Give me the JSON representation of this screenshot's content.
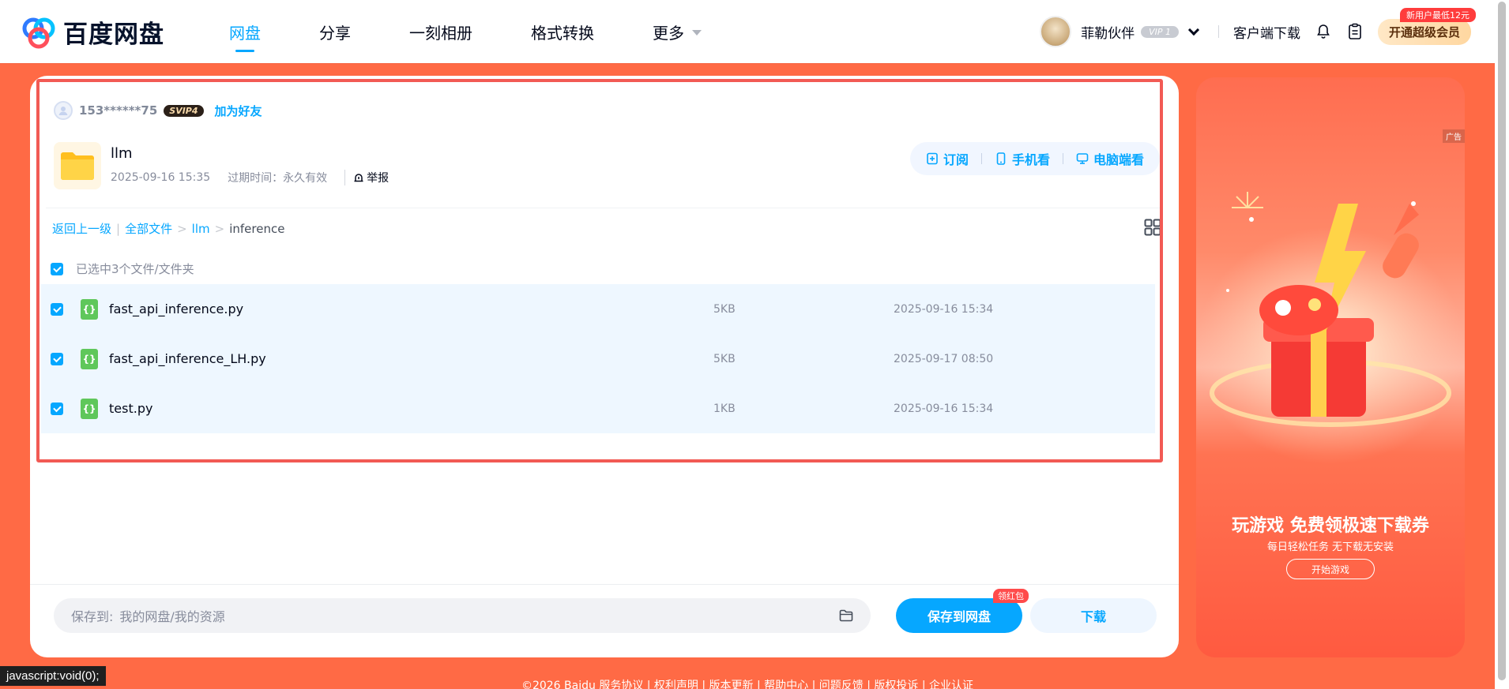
{
  "brand": {
    "name": "百度网盘"
  },
  "nav": [
    {
      "label": "网盘"
    },
    {
      "label": "分享"
    },
    {
      "label": "一刻相册"
    },
    {
      "label": "格式转换"
    },
    {
      "label": "更多"
    }
  ],
  "user": {
    "name": "菲勒伙伴",
    "vip_level": "VIP 1",
    "client_download": "客户端下载",
    "super_vip": "开通超级会员",
    "promo": "新用户最低12元"
  },
  "share": {
    "sharer_id": "153******75",
    "sharer_vip": "SVIP4",
    "add_friend": "加为好友",
    "folder_name": "llm",
    "created": "2025-09-16 15:35",
    "expire": "过期时间：永久有效",
    "report": "举报",
    "actions": {
      "subscribe": "订阅",
      "mobile": "手机看",
      "pc": "电脑端看"
    }
  },
  "breadcrumb": {
    "back": "返回上一级",
    "all": "全部文件",
    "parent": "llm",
    "current": "inference"
  },
  "selection": {
    "text": "已选中3个文件/文件夹"
  },
  "files": [
    {
      "name": "fast_api_inference.py",
      "size": "5KB",
      "date": "2025-09-16 15:34"
    },
    {
      "name": "fast_api_inference_LH.py",
      "size": "5KB",
      "date": "2025-09-17 08:50"
    },
    {
      "name": "test.py",
      "size": "1KB",
      "date": "2025-09-16 15:34"
    }
  ],
  "save": {
    "label": "保存到:",
    "path": "我的网盘/我的资源",
    "save_button": "保存到网盘",
    "red_packet": "领红包",
    "download_button": "下载"
  },
  "ad": {
    "tag": "广告",
    "title": "玩游戏 免费领极速下载券",
    "subtitle": "每日轻松任务 无下载无安装",
    "button": "开始游戏"
  },
  "footer": {
    "text": "©2026 Baidu  服务协议 | 权利声明 | 版本更新 | 帮助中心 | 问题反馈 | 版权投诉 | 企业认证"
  },
  "status_tip": "javascript:void(0);",
  "colors": {
    "accent": "#06a7ff",
    "background": "#ff6a45",
    "highlight_border": "#f25a54"
  }
}
